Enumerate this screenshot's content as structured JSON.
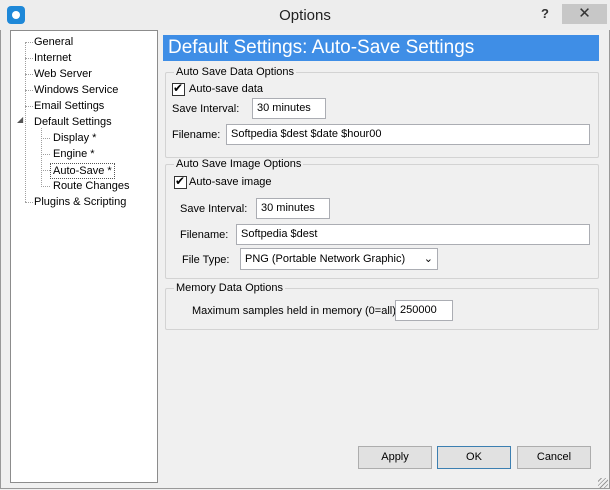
{
  "window": {
    "title": "Options",
    "help_glyph": "?",
    "close_glyph": "✕"
  },
  "tree": [
    {
      "label": "General"
    },
    {
      "label": "Internet"
    },
    {
      "label": "Web Server"
    },
    {
      "label": "Windows Service"
    },
    {
      "label": "Email Settings"
    },
    {
      "label": "Default Settings"
    },
    {
      "label": "Display *"
    },
    {
      "label": "Engine *"
    },
    {
      "label": "Auto-Save *"
    },
    {
      "label": "Route Changes"
    },
    {
      "label": "Plugins & Scripting"
    }
  ],
  "header": {
    "title": "Default Settings: Auto-Save Settings"
  },
  "data_options": {
    "title": "Auto Save Data Options",
    "autosave_label": "Auto-save data",
    "autosave_checked": true,
    "interval_label": "Save Interval:",
    "interval_value": "30 minutes",
    "filename_label": "Filename:",
    "filename_value": "Softpedia $dest $date $hour00"
  },
  "image_options": {
    "title": "Auto Save Image Options",
    "autosave_label": "Auto-save image",
    "autosave_checked": true,
    "interval_label": "Save Interval:",
    "interval_value": "30 minutes",
    "filename_label": "Filename:",
    "filename_value": "Softpedia $dest",
    "filetype_label": "File Type:",
    "filetype_value": "PNG (Portable Network Graphic)"
  },
  "memory_options": {
    "title": "Memory Data Options",
    "max_samples_label": "Maximum samples held in memory (0=all):",
    "max_samples_value": "250000"
  },
  "buttons": {
    "apply": "Apply",
    "ok": "OK",
    "cancel": "Cancel"
  }
}
